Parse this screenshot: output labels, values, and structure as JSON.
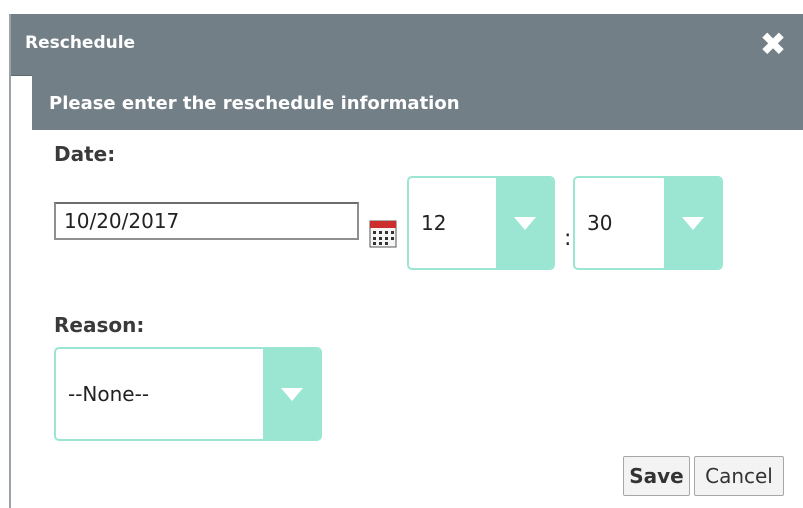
{
  "dialog": {
    "title": "Reschedule",
    "close_icon": "close-icon",
    "subheader": "Please enter the reschedule information"
  },
  "form": {
    "date_label": "Date:",
    "date_value": "10/20/2017",
    "calendar_icon": "calendar-icon",
    "hour_value": "12",
    "time_separator": ":",
    "minute_value": "30",
    "reason_label": "Reason:",
    "reason_value": "--None--"
  },
  "actions": {
    "save_label": "Save",
    "cancel_label": "Cancel"
  },
  "colors": {
    "header": "#737f86",
    "select_accent": "#9be6d3"
  }
}
